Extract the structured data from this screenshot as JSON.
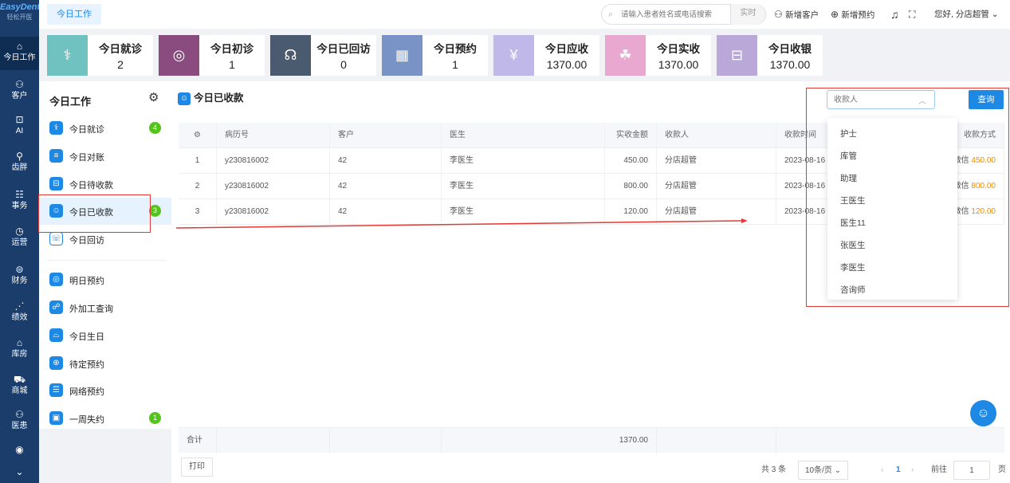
{
  "brand": {
    "name": "EasyDent",
    "tagline": "轻松开医"
  },
  "nav": [
    {
      "label": "今日工作",
      "icon": "home-icon",
      "glyph": "⌂"
    },
    {
      "label": "客户",
      "icon": "user-icon",
      "glyph": "⚇"
    },
    {
      "label": "AI",
      "icon": "ai-icon",
      "glyph": "⊡"
    },
    {
      "label": "齿胖",
      "icon": "tooth-icon",
      "glyph": "⚲"
    },
    {
      "label": "事务",
      "icon": "document-icon",
      "glyph": "☷"
    },
    {
      "label": "运营",
      "icon": "clock-icon",
      "glyph": "◷"
    },
    {
      "label": "财务",
      "icon": "wallet-icon",
      "glyph": "⊜"
    },
    {
      "label": "绩效",
      "icon": "chart-icon",
      "glyph": "⋰"
    },
    {
      "label": "库房",
      "icon": "warehouse-icon",
      "glyph": "⌂"
    },
    {
      "label": "商城",
      "icon": "cart-icon",
      "glyph": "⛟"
    },
    {
      "label": "医患",
      "icon": "people-icon",
      "glyph": "⚇"
    },
    {
      "label": "",
      "icon": "wave-icon",
      "glyph": "◉"
    },
    {
      "label": "",
      "icon": "chevron-down-icon",
      "glyph": "⌄"
    }
  ],
  "topbar": {
    "tab": "今日工作",
    "search_placeholder": "请输入患者姓名或电话搜索",
    "realtime": "实时",
    "new_customer": "新增客户",
    "new_appointment": "新增预约",
    "greeting": "您好, 分店超管"
  },
  "cards": [
    {
      "label": "今日就诊",
      "value": "2",
      "color": "#6fc2c0",
      "icon": "visit-icon",
      "glyph": "⚕"
    },
    {
      "label": "今日初诊",
      "value": "1",
      "color": "#8a4b7e",
      "icon": "first-visit-icon",
      "glyph": "◎"
    },
    {
      "label": "今日已回访",
      "value": "0",
      "color": "#4a5b70",
      "icon": "headset-icon",
      "glyph": "☊"
    },
    {
      "label": "今日预约",
      "value": "1",
      "color": "#7a93c6",
      "icon": "calendar-icon",
      "glyph": "▦"
    },
    {
      "label": "今日应收",
      "value": "1370.00",
      "color": "#c0b8e8",
      "icon": "receivable-icon",
      "glyph": "¥"
    },
    {
      "label": "今日实收",
      "value": "1370.00",
      "color": "#e8a8d0",
      "icon": "received-icon",
      "glyph": "☘"
    },
    {
      "label": "今日收银",
      "value": "1370.00",
      "color": "#b9a8d8",
      "icon": "cashier-icon",
      "glyph": "⊟"
    }
  ],
  "side": {
    "title": "今日工作",
    "items": [
      {
        "label": "今日就诊",
        "badge": "4",
        "icon": "visit-icon",
        "glyph": "⚕"
      },
      {
        "label": "今日对账",
        "badge": "",
        "icon": "ledger-icon",
        "glyph": "≡"
      },
      {
        "label": "今日待收款",
        "badge": "",
        "icon": "pending-payment-icon",
        "glyph": "⊟"
      },
      {
        "label": "今日已收款",
        "badge": "3",
        "icon": "received-icon",
        "glyph": "☺"
      },
      {
        "label": "今日回访",
        "badge": "",
        "icon": "followup-icon",
        "glyph": "☏"
      },
      {
        "label": "明日预约",
        "badge": "",
        "icon": "tomorrow-icon",
        "glyph": "◎"
      },
      {
        "label": "外加工查询",
        "badge": "",
        "icon": "outsource-icon",
        "glyph": "☍"
      },
      {
        "label": "今日生日",
        "badge": "",
        "icon": "cake-icon",
        "glyph": "⌓"
      },
      {
        "label": "待定预约",
        "badge": "",
        "icon": "pending-appointment-icon",
        "glyph": "⊕"
      },
      {
        "label": "网络预约",
        "badge": "",
        "icon": "online-icon",
        "glyph": "☰"
      },
      {
        "label": "一周失约",
        "badge": "1",
        "icon": "missed-icon",
        "glyph": "▣"
      }
    ]
  },
  "main": {
    "title": "今日已收款",
    "payee_placeholder": "收款人",
    "query": "查询",
    "columns": [
      "⚙",
      "病历号",
      "客户",
      "医生",
      "实收金额",
      "收款人",
      "收款时间",
      "收款方式"
    ],
    "rows": [
      {
        "no": "1",
        "record": "y230816002",
        "customer": "42",
        "doctor": "李医生",
        "amount": "450.00",
        "payee": "分店超管",
        "time": "2023-08-16",
        "method": "微信",
        "method_amount": "450.00"
      },
      {
        "no": "2",
        "record": "y230816002",
        "customer": "42",
        "doctor": "李医生",
        "amount": "800.00",
        "payee": "分店超管",
        "time": "2023-08-16",
        "method": "微信",
        "method_amount": "800.00"
      },
      {
        "no": "3",
        "record": "y230816002",
        "customer": "42",
        "doctor": "李医生",
        "amount": "120.00",
        "payee": "分店超管",
        "time": "2023-08-16",
        "method": "微信",
        "method_amount": "120.00"
      }
    ],
    "total_label": "合计",
    "total": "1370.00",
    "print": "打印",
    "pager": {
      "total": "共 3 条",
      "page_size": "10条/页",
      "page": "1",
      "goto": "前往",
      "goto_value": "1",
      "page_unit": "页"
    }
  },
  "dropdown_options": [
    "护士",
    "库管",
    "助理",
    "王医生",
    "医生11",
    "张医生",
    "李医生",
    "咨询师"
  ],
  "colors": {
    "primary": "#1e88e5",
    "nav": "#1a3d6b",
    "highlight": "#e53935",
    "badge": "#52c41a",
    "payment": "#f08c00"
  }
}
